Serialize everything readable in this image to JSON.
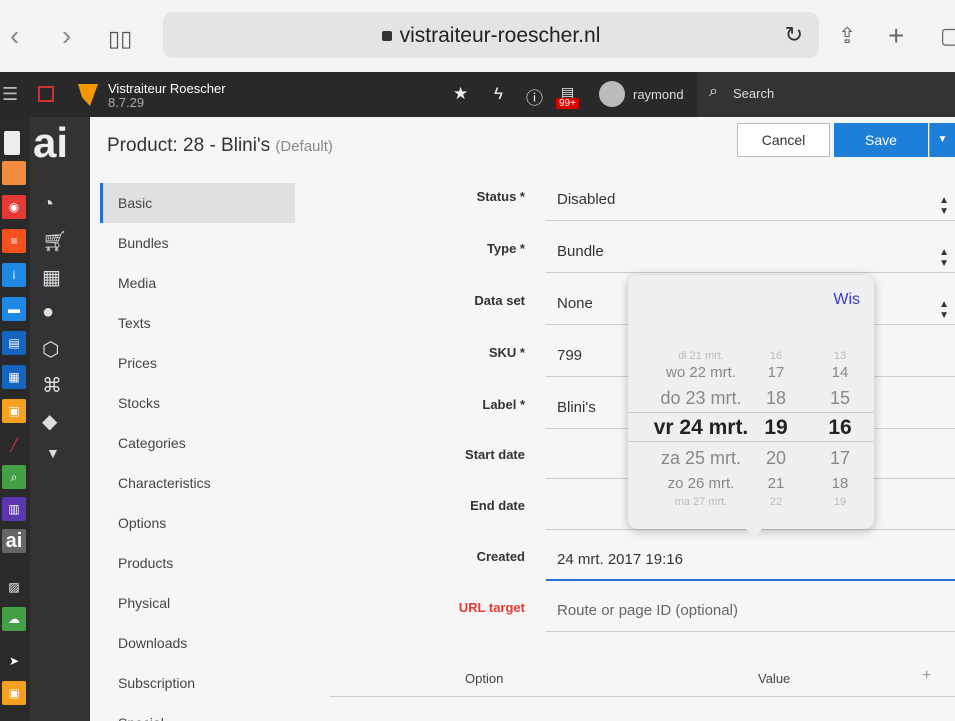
{
  "browser": {
    "url": "vistraiteur-roescher.nl",
    "back_icon": "chevron-left-icon",
    "forward_icon": "chevron-right-icon",
    "bookmarks_icon": "book-icon",
    "reload_icon": "reload-icon",
    "share_icon": "share-icon",
    "newtab_icon": "plus-icon",
    "tabs_icon": "tabs-icon"
  },
  "topbar": {
    "site_name": "Vistraiteur Roescher",
    "version": "8.7.29",
    "badge": "99+",
    "username": "raymond",
    "search_label": "Search"
  },
  "left_modules": {
    "ai_label": "ai",
    "ai_label_small": "ai"
  },
  "product": {
    "title": "Product: 28 - Blini's",
    "title_suffix": "(Default)",
    "cancel_label": "Cancel",
    "save_label": "Save"
  },
  "tabs": [
    "Basic",
    "Bundles",
    "Media",
    "Texts",
    "Prices",
    "Stocks",
    "Categories",
    "Characteristics",
    "Options",
    "Products",
    "Physical",
    "Downloads",
    "Subscription",
    "Special"
  ],
  "fields": {
    "status": {
      "label": "Status *",
      "value": "Disabled"
    },
    "type": {
      "label": "Type *",
      "value": "Bundle"
    },
    "dataset": {
      "label": "Data set",
      "value": "None"
    },
    "sku": {
      "label": "SKU *",
      "value": "799"
    },
    "label": {
      "label": "Label *",
      "value": "Blini's"
    },
    "start_date": {
      "label": "Start date",
      "value": ""
    },
    "end_date": {
      "label": "End date",
      "value": ""
    },
    "created": {
      "label": "Created",
      "value": "24 mrt. 2017 19:16"
    },
    "url_target": {
      "label": "URL target",
      "placeholder": "Route or page ID (optional)"
    }
  },
  "options_table": {
    "col_option": "Option",
    "col_value": "Value",
    "add_icon": "plus-icon"
  },
  "date_picker": {
    "clear_label": "Wis",
    "rows": [
      {
        "day": "di 21 mrt.",
        "hour": "16",
        "minute": "13"
      },
      {
        "day": "wo 22 mrt.",
        "hour": "17",
        "minute": "14"
      },
      {
        "day": "do 23 mrt.",
        "hour": "18",
        "minute": "15"
      },
      {
        "day": "vr 24 mrt.",
        "hour": "19",
        "minute": "16"
      },
      {
        "day": "za 25 mrt.",
        "hour": "20",
        "minute": "17"
      },
      {
        "day": "zo 26 mrt.",
        "hour": "21",
        "minute": "18"
      },
      {
        "day": "ma 27 mrt.",
        "hour": "22",
        "minute": "19"
      }
    ],
    "selected_index": 3
  }
}
